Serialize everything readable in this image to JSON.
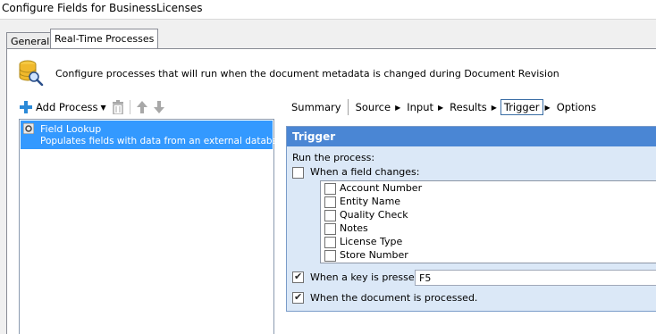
{
  "window": {
    "title": "Configure Fields for BusinessLicenses"
  },
  "tabs": [
    {
      "label": "General",
      "active": false
    },
    {
      "label": "Real-Time Processes",
      "active": true
    }
  ],
  "description": "Configure processes that will run when the document metadata is changed during Document Revision",
  "toolbar": {
    "add_process_label": "Add Process",
    "icons": [
      "plus-icon",
      "dropdown-caret-icon",
      "trash-icon",
      "arrow-up-icon",
      "arrow-down-icon"
    ]
  },
  "processes": [
    {
      "name": "Field Lookup",
      "description": "Populates fields with data from an external database.",
      "selected": true
    }
  ],
  "steps": [
    "Summary",
    "Source",
    "Input",
    "Results",
    "Trigger",
    "Options"
  ],
  "active_step": "Trigger",
  "trigger": {
    "title": "Trigger",
    "run_label": "Run the process:",
    "field_change": {
      "label": "When a field changes:",
      "checked": false
    },
    "fields": [
      {
        "name": "Account Number",
        "checked": false
      },
      {
        "name": "Entity Name",
        "checked": false
      },
      {
        "name": "Quality Check",
        "checked": false
      },
      {
        "name": "Notes",
        "checked": false
      },
      {
        "name": "License Type",
        "checked": false
      },
      {
        "name": "Store Number",
        "checked": false
      }
    ],
    "key_pressed": {
      "label": "When a key is pressed:",
      "checked": true,
      "value": "F5"
    },
    "doc_processed": {
      "label": "When the document is processed.",
      "checked": true
    }
  },
  "colors": {
    "selection": "#3399ff",
    "trigger_header": "#4a86d4",
    "trigger_background": "#dbe8f7"
  }
}
